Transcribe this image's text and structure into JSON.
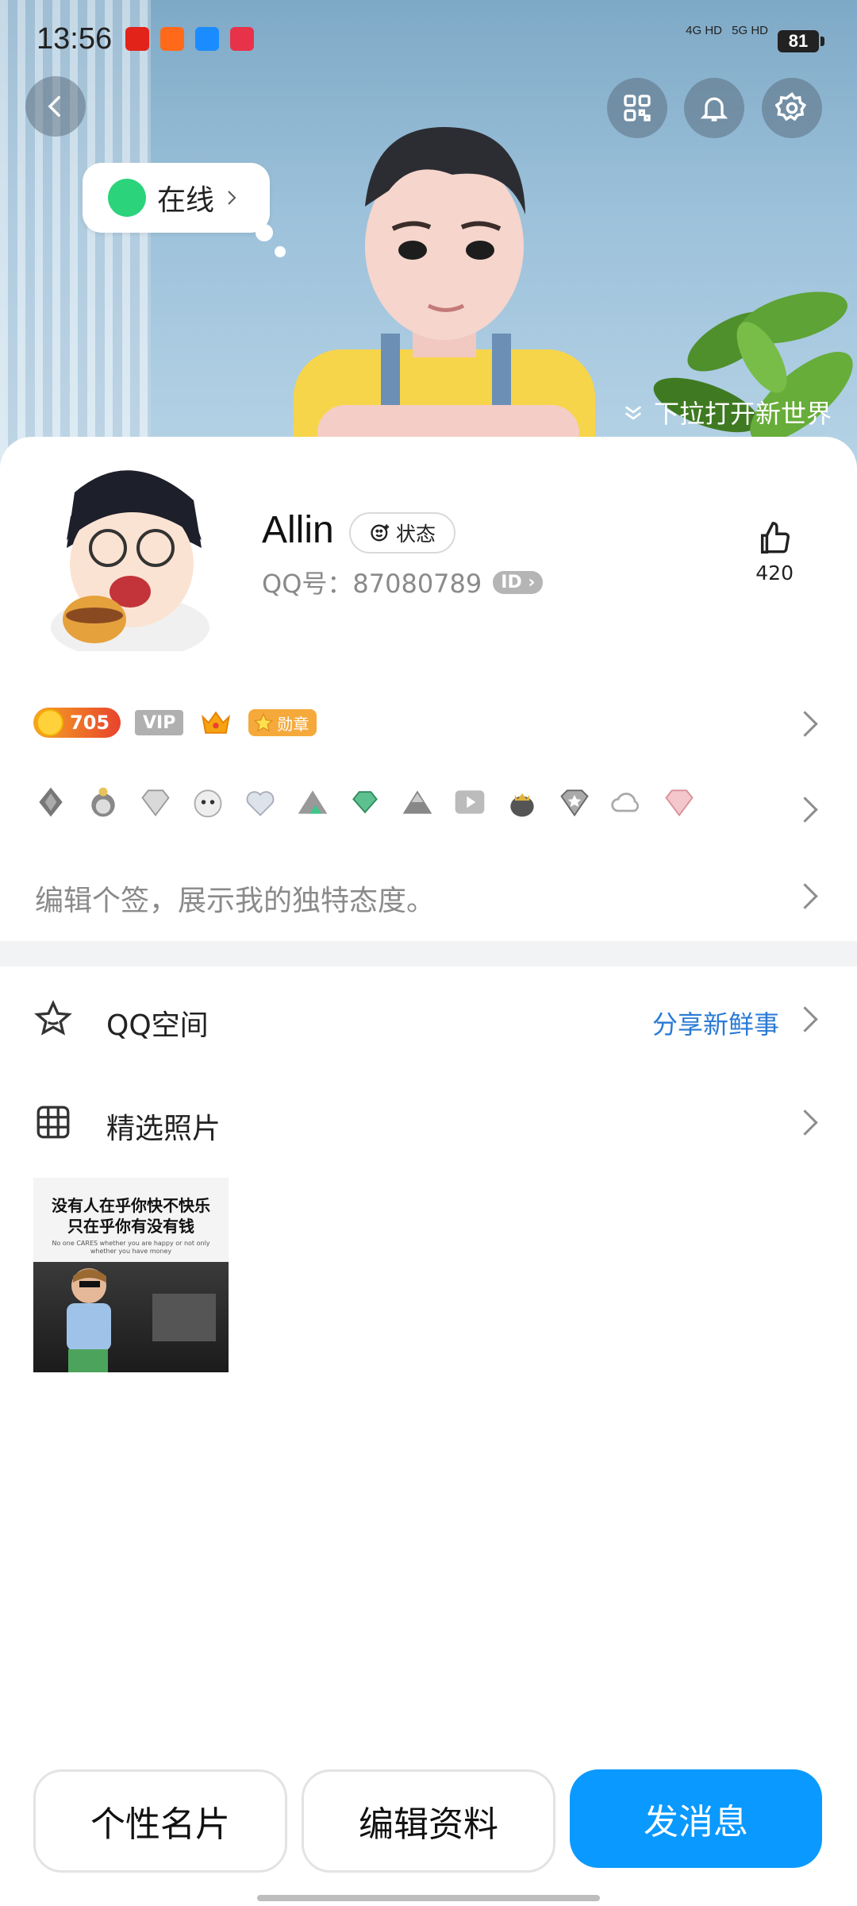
{
  "status_bar": {
    "time": "13:56",
    "signal_1": "4G HD",
    "signal_2": "5G HD",
    "battery": "81"
  },
  "hero": {
    "online_label": "在线",
    "pull_hint": "下拉打开新世界"
  },
  "profile": {
    "name": "Allin",
    "state_label": "状态",
    "qq_label": "QQ号：87080789",
    "id_chip": "ID",
    "like_count": "420"
  },
  "badges": {
    "coin_value": "705",
    "vip_label": "VIP",
    "medal_label": "勋章"
  },
  "signature": {
    "placeholder": "编辑个签，展示我的独特态度。"
  },
  "rows": {
    "qzone_label": "QQ空间",
    "qzone_action": "分享新鲜事",
    "photos_label": "精选照片"
  },
  "photo": {
    "caption_cn_1": "没有人在乎你快不快乐",
    "caption_cn_2": "只在乎你有没有钱",
    "caption_en": "No one CARES whether you are happy or not only whether you have money"
  },
  "actions": {
    "card_button": "个性名片",
    "edit_button": "编辑资料",
    "message_button": "发消息"
  },
  "colors": {
    "accent": "#0a99ff",
    "link": "#2a7ad5",
    "online": "#2bd37b"
  }
}
